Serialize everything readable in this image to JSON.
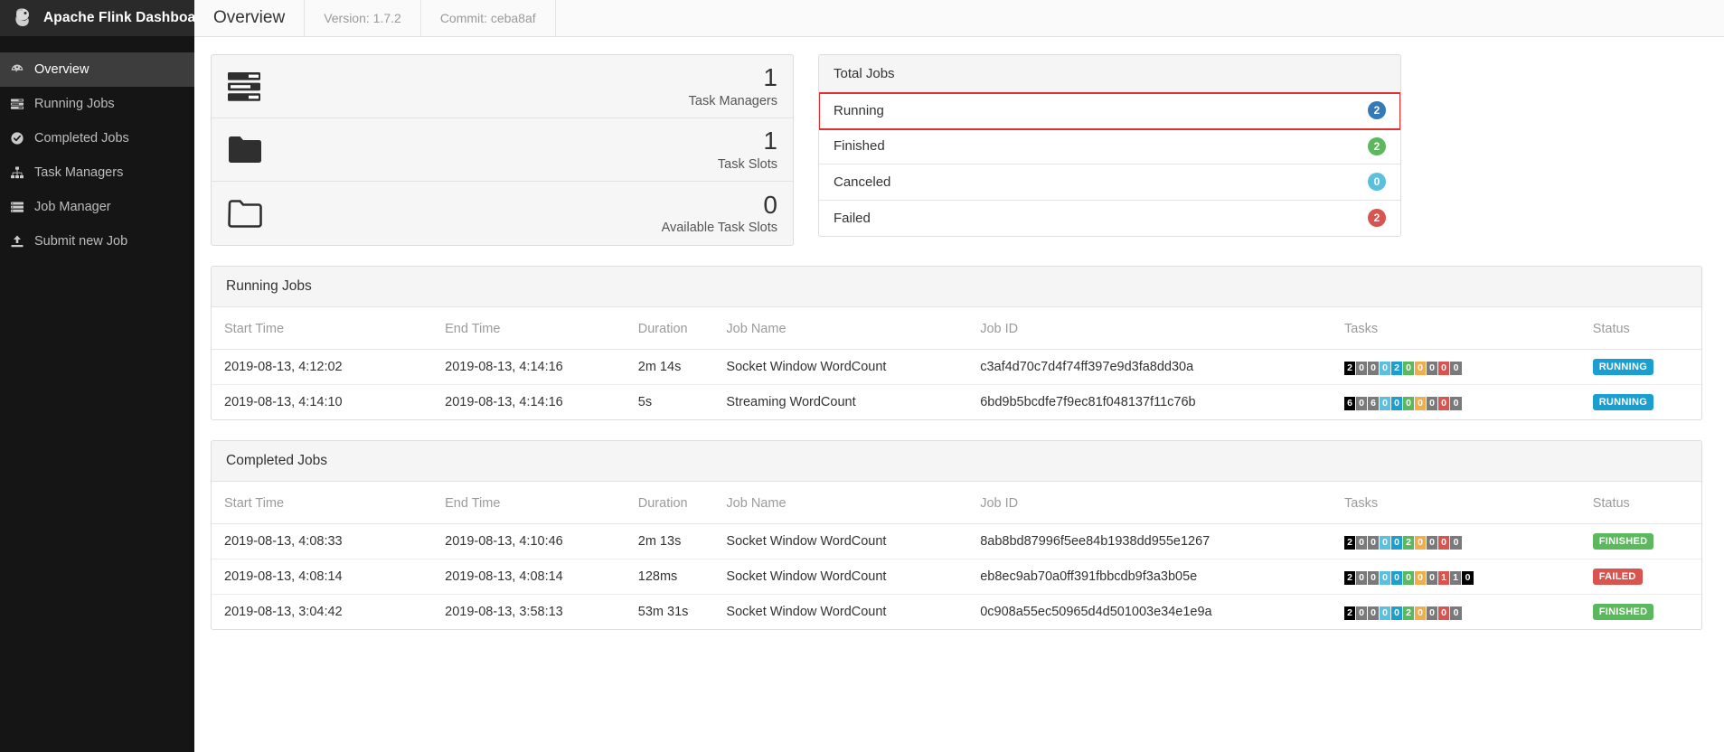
{
  "brand": {
    "title": "Apache Flink Dashboard",
    "logo_icon": "flink-squirrel-logo"
  },
  "sidebar": {
    "items": [
      {
        "label": "Overview",
        "icon": "dashboard-icon",
        "active": true
      },
      {
        "label": "Running Jobs",
        "icon": "server-list-icon",
        "active": false
      },
      {
        "label": "Completed Jobs",
        "icon": "check-circle-icon",
        "active": false
      },
      {
        "label": "Task Managers",
        "icon": "sitemap-icon",
        "active": false
      },
      {
        "label": "Job Manager",
        "icon": "server-stack-icon",
        "active": false
      },
      {
        "label": "Submit new Job",
        "icon": "upload-icon",
        "active": false
      }
    ]
  },
  "topbar": {
    "title": "Overview",
    "version": "Version: 1.7.2",
    "commit": "Commit: ceba8af"
  },
  "stats": [
    {
      "icon": "servers-icon",
      "value": "1",
      "label": "Task Managers"
    },
    {
      "icon": "folder-full-icon",
      "value": "1",
      "label": "Task Slots"
    },
    {
      "icon": "folder-open-icon",
      "value": "0",
      "label": "Available Task Slots"
    }
  ],
  "total_jobs": {
    "header": "Total Jobs",
    "rows": [
      {
        "label": "Running",
        "count": "2",
        "color": "#337ab7",
        "highlighted": true
      },
      {
        "label": "Finished",
        "count": "2",
        "color": "#5cb85c",
        "highlighted": false
      },
      {
        "label": "Canceled",
        "count": "0",
        "color": "#5bc0de",
        "highlighted": false
      },
      {
        "label": "Failed",
        "count": "2",
        "color": "#d9534f",
        "highlighted": false
      }
    ]
  },
  "chip_colors": [
    "#000000",
    "#7a7a7a",
    "#7a7a7a",
    "#5bc0de",
    "#1b9ed0",
    "#5cb85c",
    "#f0ad4e",
    "#7a7a7a",
    "#d9534f",
    "#7a7a7a"
  ],
  "running_jobs": {
    "header": "Running Jobs",
    "columns": [
      "Start Time",
      "End Time",
      "Duration",
      "Job Name",
      "Job ID",
      "Tasks",
      "Status"
    ],
    "rows": [
      {
        "start": "2019-08-13, 4:12:02",
        "end": "2019-08-13, 4:14:16",
        "duration": "2m 14s",
        "name": "Socket Window WordCount",
        "id": "c3af4d70c7d4f74ff397e9d3fa8dd30a",
        "tasks": [
          "2",
          "0",
          "0",
          "0",
          "2",
          "0",
          "0",
          "0",
          "0",
          "0"
        ],
        "status": "RUNNING",
        "status_color": "#1b9ed0"
      },
      {
        "start": "2019-08-13, 4:14:10",
        "end": "2019-08-13, 4:14:16",
        "duration": "5s",
        "name": "Streaming WordCount",
        "id": "6bd9b5bcdfe7f9ec81f048137f11c76b",
        "tasks": [
          "6",
          "0",
          "6",
          "0",
          "0",
          "0",
          "0",
          "0",
          "0",
          "0"
        ],
        "status": "RUNNING",
        "status_color": "#1b9ed0"
      }
    ]
  },
  "completed_jobs": {
    "header": "Completed Jobs",
    "columns": [
      "Start Time",
      "End Time",
      "Duration",
      "Job Name",
      "Job ID",
      "Tasks",
      "Status"
    ],
    "rows": [
      {
        "start": "2019-08-13, 4:08:33",
        "end": "2019-08-13, 4:10:46",
        "duration": "2m 13s",
        "name": "Socket Window WordCount",
        "id": "8ab8bd87996f5ee84b1938dd955e1267",
        "tasks": [
          "2",
          "0",
          "0",
          "0",
          "0",
          "2",
          "0",
          "0",
          "0",
          "0"
        ],
        "status": "FINISHED",
        "status_color": "#5cb85c"
      },
      {
        "start": "2019-08-13, 4:08:14",
        "end": "2019-08-13, 4:08:14",
        "duration": "128ms",
        "name": "Socket Window WordCount",
        "id": "eb8ec9ab70a0ff391fbbcdb9f3a3b05e",
        "tasks": [
          "2",
          "0",
          "0",
          "0",
          "0",
          "0",
          "0",
          "0",
          "1",
          "1",
          "0"
        ],
        "status": "FAILED",
        "status_color": "#d9534f"
      },
      {
        "start": "2019-08-13, 3:04:42",
        "end": "2019-08-13, 3:58:13",
        "duration": "53m 31s",
        "name": "Socket Window WordCount",
        "id": "0c908a55ec50965d4d501003e34e1e9a",
        "tasks": [
          "2",
          "0",
          "0",
          "0",
          "0",
          "2",
          "0",
          "0",
          "0",
          "0"
        ],
        "status": "FINISHED",
        "status_color": "#5cb85c"
      }
    ]
  }
}
